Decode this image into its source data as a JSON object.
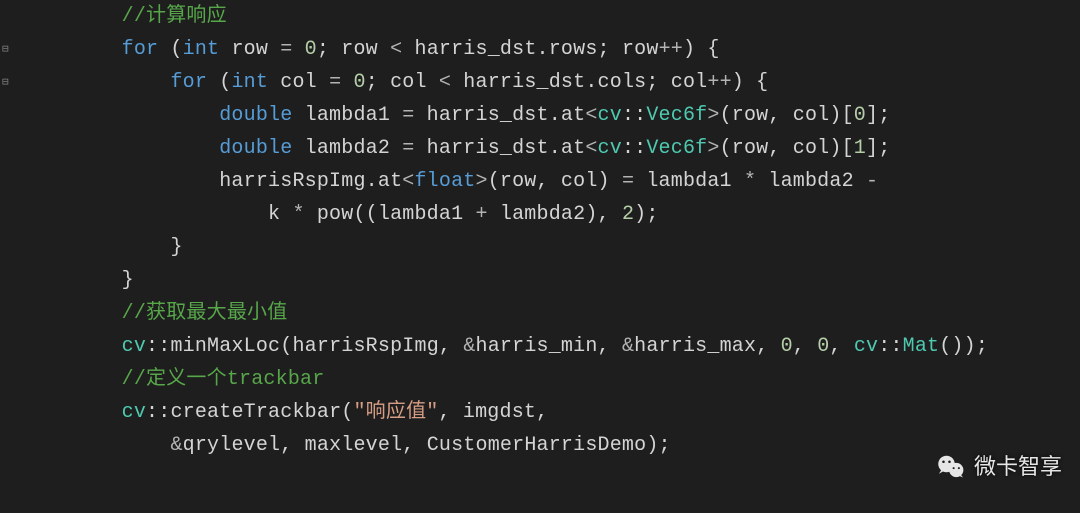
{
  "code": {
    "lines": [
      {
        "indent": 2,
        "tokens": [
          {
            "t": "comment",
            "v": "//计算响应"
          }
        ]
      },
      {
        "indent": 2,
        "tokens": [
          {
            "t": "keyword",
            "v": "for"
          },
          {
            "t": "punc",
            "v": " ("
          },
          {
            "t": "type",
            "v": "int"
          },
          {
            "t": "ident",
            "v": " row "
          },
          {
            "t": "op",
            "v": "="
          },
          {
            "t": "ident",
            "v": " "
          },
          {
            "t": "number",
            "v": "0"
          },
          {
            "t": "punc",
            "v": "; "
          },
          {
            "t": "ident",
            "v": "row "
          },
          {
            "t": "op",
            "v": "<"
          },
          {
            "t": "ident",
            "v": " harris_dst"
          },
          {
            "t": "punc",
            "v": "."
          },
          {
            "t": "ident",
            "v": "rows"
          },
          {
            "t": "punc",
            "v": "; "
          },
          {
            "t": "ident",
            "v": "row"
          },
          {
            "t": "op",
            "v": "++"
          },
          {
            "t": "punc",
            "v": ") {"
          }
        ]
      },
      {
        "indent": 3,
        "tokens": [
          {
            "t": "keyword",
            "v": "for"
          },
          {
            "t": "punc",
            "v": " ("
          },
          {
            "t": "type",
            "v": "int"
          },
          {
            "t": "ident",
            "v": " col "
          },
          {
            "t": "op",
            "v": "="
          },
          {
            "t": "ident",
            "v": " "
          },
          {
            "t": "number",
            "v": "0"
          },
          {
            "t": "punc",
            "v": "; "
          },
          {
            "t": "ident",
            "v": "col "
          },
          {
            "t": "op",
            "v": "<"
          },
          {
            "t": "ident",
            "v": " harris_dst"
          },
          {
            "t": "punc",
            "v": "."
          },
          {
            "t": "ident",
            "v": "cols"
          },
          {
            "t": "punc",
            "v": "; "
          },
          {
            "t": "ident",
            "v": "col"
          },
          {
            "t": "op",
            "v": "++"
          },
          {
            "t": "punc",
            "v": ") {"
          }
        ]
      },
      {
        "indent": 4,
        "tokens": [
          {
            "t": "type",
            "v": "double"
          },
          {
            "t": "ident",
            "v": " lambda1 "
          },
          {
            "t": "op",
            "v": "="
          },
          {
            "t": "ident",
            "v": " harris_dst"
          },
          {
            "t": "punc",
            "v": "."
          },
          {
            "t": "ident",
            "v": "at"
          },
          {
            "t": "op",
            "v": "<"
          },
          {
            "t": "ns",
            "v": "cv"
          },
          {
            "t": "punc",
            "v": "::"
          },
          {
            "t": "class",
            "v": "Vec6f"
          },
          {
            "t": "op",
            "v": ">"
          },
          {
            "t": "punc",
            "v": "("
          },
          {
            "t": "ident",
            "v": "row"
          },
          {
            "t": "punc",
            "v": ", "
          },
          {
            "t": "ident",
            "v": "col"
          },
          {
            "t": "punc",
            "v": ")["
          },
          {
            "t": "number",
            "v": "0"
          },
          {
            "t": "punc",
            "v": "];"
          }
        ]
      },
      {
        "indent": 4,
        "tokens": [
          {
            "t": "type",
            "v": "double"
          },
          {
            "t": "ident",
            "v": " lambda2 "
          },
          {
            "t": "op",
            "v": "="
          },
          {
            "t": "ident",
            "v": " harris_dst"
          },
          {
            "t": "punc",
            "v": "."
          },
          {
            "t": "ident",
            "v": "at"
          },
          {
            "t": "op",
            "v": "<"
          },
          {
            "t": "ns",
            "v": "cv"
          },
          {
            "t": "punc",
            "v": "::"
          },
          {
            "t": "class",
            "v": "Vec6f"
          },
          {
            "t": "op",
            "v": ">"
          },
          {
            "t": "punc",
            "v": "("
          },
          {
            "t": "ident",
            "v": "row"
          },
          {
            "t": "punc",
            "v": ", "
          },
          {
            "t": "ident",
            "v": "col"
          },
          {
            "t": "punc",
            "v": ")["
          },
          {
            "t": "number",
            "v": "1"
          },
          {
            "t": "punc",
            "v": "];"
          }
        ]
      },
      {
        "indent": 4,
        "tokens": [
          {
            "t": "ident",
            "v": "harrisRspImg"
          },
          {
            "t": "punc",
            "v": "."
          },
          {
            "t": "ident",
            "v": "at"
          },
          {
            "t": "op",
            "v": "<"
          },
          {
            "t": "type",
            "v": "float"
          },
          {
            "t": "op",
            "v": ">"
          },
          {
            "t": "punc",
            "v": "("
          },
          {
            "t": "ident",
            "v": "row"
          },
          {
            "t": "punc",
            "v": ", "
          },
          {
            "t": "ident",
            "v": "col"
          },
          {
            "t": "punc",
            "v": ") "
          },
          {
            "t": "op",
            "v": "="
          },
          {
            "t": "ident",
            "v": " lambda1 "
          },
          {
            "t": "op",
            "v": "*"
          },
          {
            "t": "ident",
            "v": " lambda2 "
          },
          {
            "t": "op",
            "v": "-"
          }
        ]
      },
      {
        "indent": 5,
        "tokens": [
          {
            "t": "ident",
            "v": "k "
          },
          {
            "t": "op",
            "v": "*"
          },
          {
            "t": "ident",
            "v": " pow"
          },
          {
            "t": "punc",
            "v": "(("
          },
          {
            "t": "ident",
            "v": "lambda1 "
          },
          {
            "t": "op",
            "v": "+"
          },
          {
            "t": "ident",
            "v": " lambda2"
          },
          {
            "t": "punc",
            "v": "), "
          },
          {
            "t": "number",
            "v": "2"
          },
          {
            "t": "punc",
            "v": ");"
          }
        ]
      },
      {
        "indent": 3,
        "tokens": [
          {
            "t": "punc",
            "v": "}"
          }
        ]
      },
      {
        "indent": 2,
        "tokens": [
          {
            "t": "punc",
            "v": "}"
          }
        ]
      },
      {
        "indent": 2,
        "tokens": [
          {
            "t": "comment",
            "v": "//获取最大最小值"
          }
        ]
      },
      {
        "indent": 2,
        "tokens": [
          {
            "t": "ns",
            "v": "cv"
          },
          {
            "t": "punc",
            "v": "::"
          },
          {
            "t": "ident",
            "v": "minMaxLoc"
          },
          {
            "t": "punc",
            "v": "("
          },
          {
            "t": "ident",
            "v": "harrisRspImg"
          },
          {
            "t": "punc",
            "v": ", "
          },
          {
            "t": "op",
            "v": "&"
          },
          {
            "t": "ident",
            "v": "harris_min"
          },
          {
            "t": "punc",
            "v": ", "
          },
          {
            "t": "op",
            "v": "&"
          },
          {
            "t": "ident",
            "v": "harris_max"
          },
          {
            "t": "punc",
            "v": ", "
          },
          {
            "t": "number",
            "v": "0"
          },
          {
            "t": "punc",
            "v": ", "
          },
          {
            "t": "number",
            "v": "0"
          },
          {
            "t": "punc",
            "v": ", "
          },
          {
            "t": "ns",
            "v": "cv"
          },
          {
            "t": "punc",
            "v": "::"
          },
          {
            "t": "class",
            "v": "Mat"
          },
          {
            "t": "punc",
            "v": "());"
          }
        ]
      },
      {
        "indent": 2,
        "tokens": [
          {
            "t": "comment",
            "v": "//定义一个trackbar"
          }
        ]
      },
      {
        "indent": 2,
        "tokens": [
          {
            "t": "ns",
            "v": "cv"
          },
          {
            "t": "punc",
            "v": "::"
          },
          {
            "t": "ident",
            "v": "createTrackbar"
          },
          {
            "t": "punc",
            "v": "("
          },
          {
            "t": "string",
            "v": "\"响应值\""
          },
          {
            "t": "punc",
            "v": ", "
          },
          {
            "t": "ident",
            "v": "imgdst"
          },
          {
            "t": "punc",
            "v": ","
          }
        ]
      },
      {
        "indent": 3,
        "tokens": [
          {
            "t": "op",
            "v": "&"
          },
          {
            "t": "ident",
            "v": "qrylevel"
          },
          {
            "t": "punc",
            "v": ", "
          },
          {
            "t": "ident",
            "v": "maxlevel"
          },
          {
            "t": "punc",
            "v": ", "
          },
          {
            "t": "ident",
            "v": "CustomerHarrisDemo"
          },
          {
            "t": "punc",
            "v": ");"
          }
        ]
      }
    ]
  },
  "fold_markers": [
    {
      "line": 1,
      "glyph": "⊟"
    },
    {
      "line": 2,
      "glyph": "⊟"
    }
  ],
  "watermark": {
    "label": "微卡智享"
  }
}
